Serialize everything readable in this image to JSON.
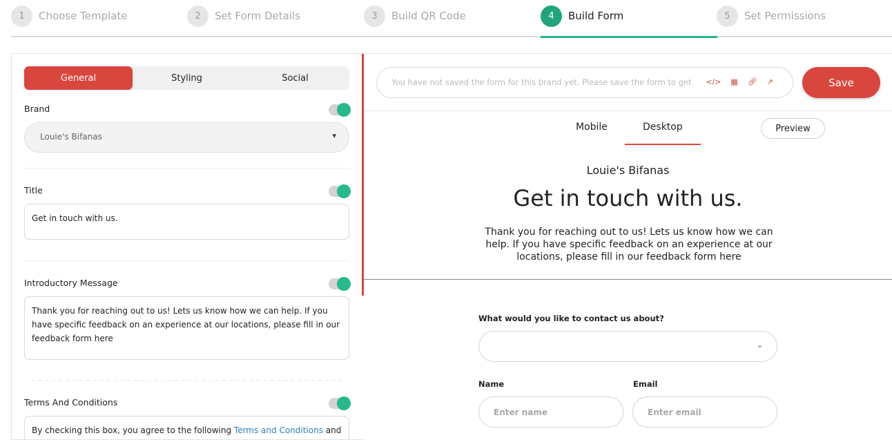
{
  "stepper": {
    "steps": [
      {
        "num": "1",
        "label": "Choose Template"
      },
      {
        "num": "2",
        "label": "Set Form Details"
      },
      {
        "num": "3",
        "label": "Build QR Code"
      },
      {
        "num": "4",
        "label": "Build Form"
      },
      {
        "num": "5",
        "label": "Set Permissions"
      }
    ],
    "active_step": 4
  },
  "left": {
    "tabs": [
      "General",
      "Styling",
      "Social"
    ],
    "brand": {
      "label": "Brand",
      "value": "Louie's Bifanas",
      "enabled": true
    },
    "title": {
      "label": "Title",
      "value": "Get in touch with us.",
      "enabled": true
    },
    "intro": {
      "label": "Introductory Message",
      "value": "Thank you for reaching out to us! Lets us know how we can help. If you have specific feedback on an experience at our locations, please fill in our feedback form here",
      "enabled": true
    },
    "terms": {
      "label": "Terms And Conditions",
      "text_before": "By checking this box, you agree to the following ",
      "link_text": "Terms and Conditions",
      "text_after": " and",
      "enabled": true
    }
  },
  "right": {
    "url_placeholder": "You have not saved the form for this brand yet. Please save the form to get",
    "url_icons": [
      "code-icon",
      "qr-icon",
      "link-icon",
      "external-link-icon"
    ],
    "save_label": "Save",
    "view_tabs": [
      "Mobile",
      "Desktop"
    ],
    "active_view": "Desktop",
    "preview_label": "Preview",
    "preview": {
      "brand_name": "Louie's Bifanas",
      "headline": "Get in touch with us.",
      "intro": "Thank you for reaching out to us! Lets us know how we can help. If you have specific feedback on an experience at our locations, please fill in our feedback form here",
      "contact_about_label": "What would you like to contact us about?",
      "name_label": "Name",
      "name_placeholder": "Enter name",
      "email_label": "Email",
      "email_placeholder": "Enter email"
    }
  },
  "colors": {
    "accent_red": "#d9463e",
    "accent_green": "#1fa47d",
    "link_blue": "#2b7fc0"
  }
}
